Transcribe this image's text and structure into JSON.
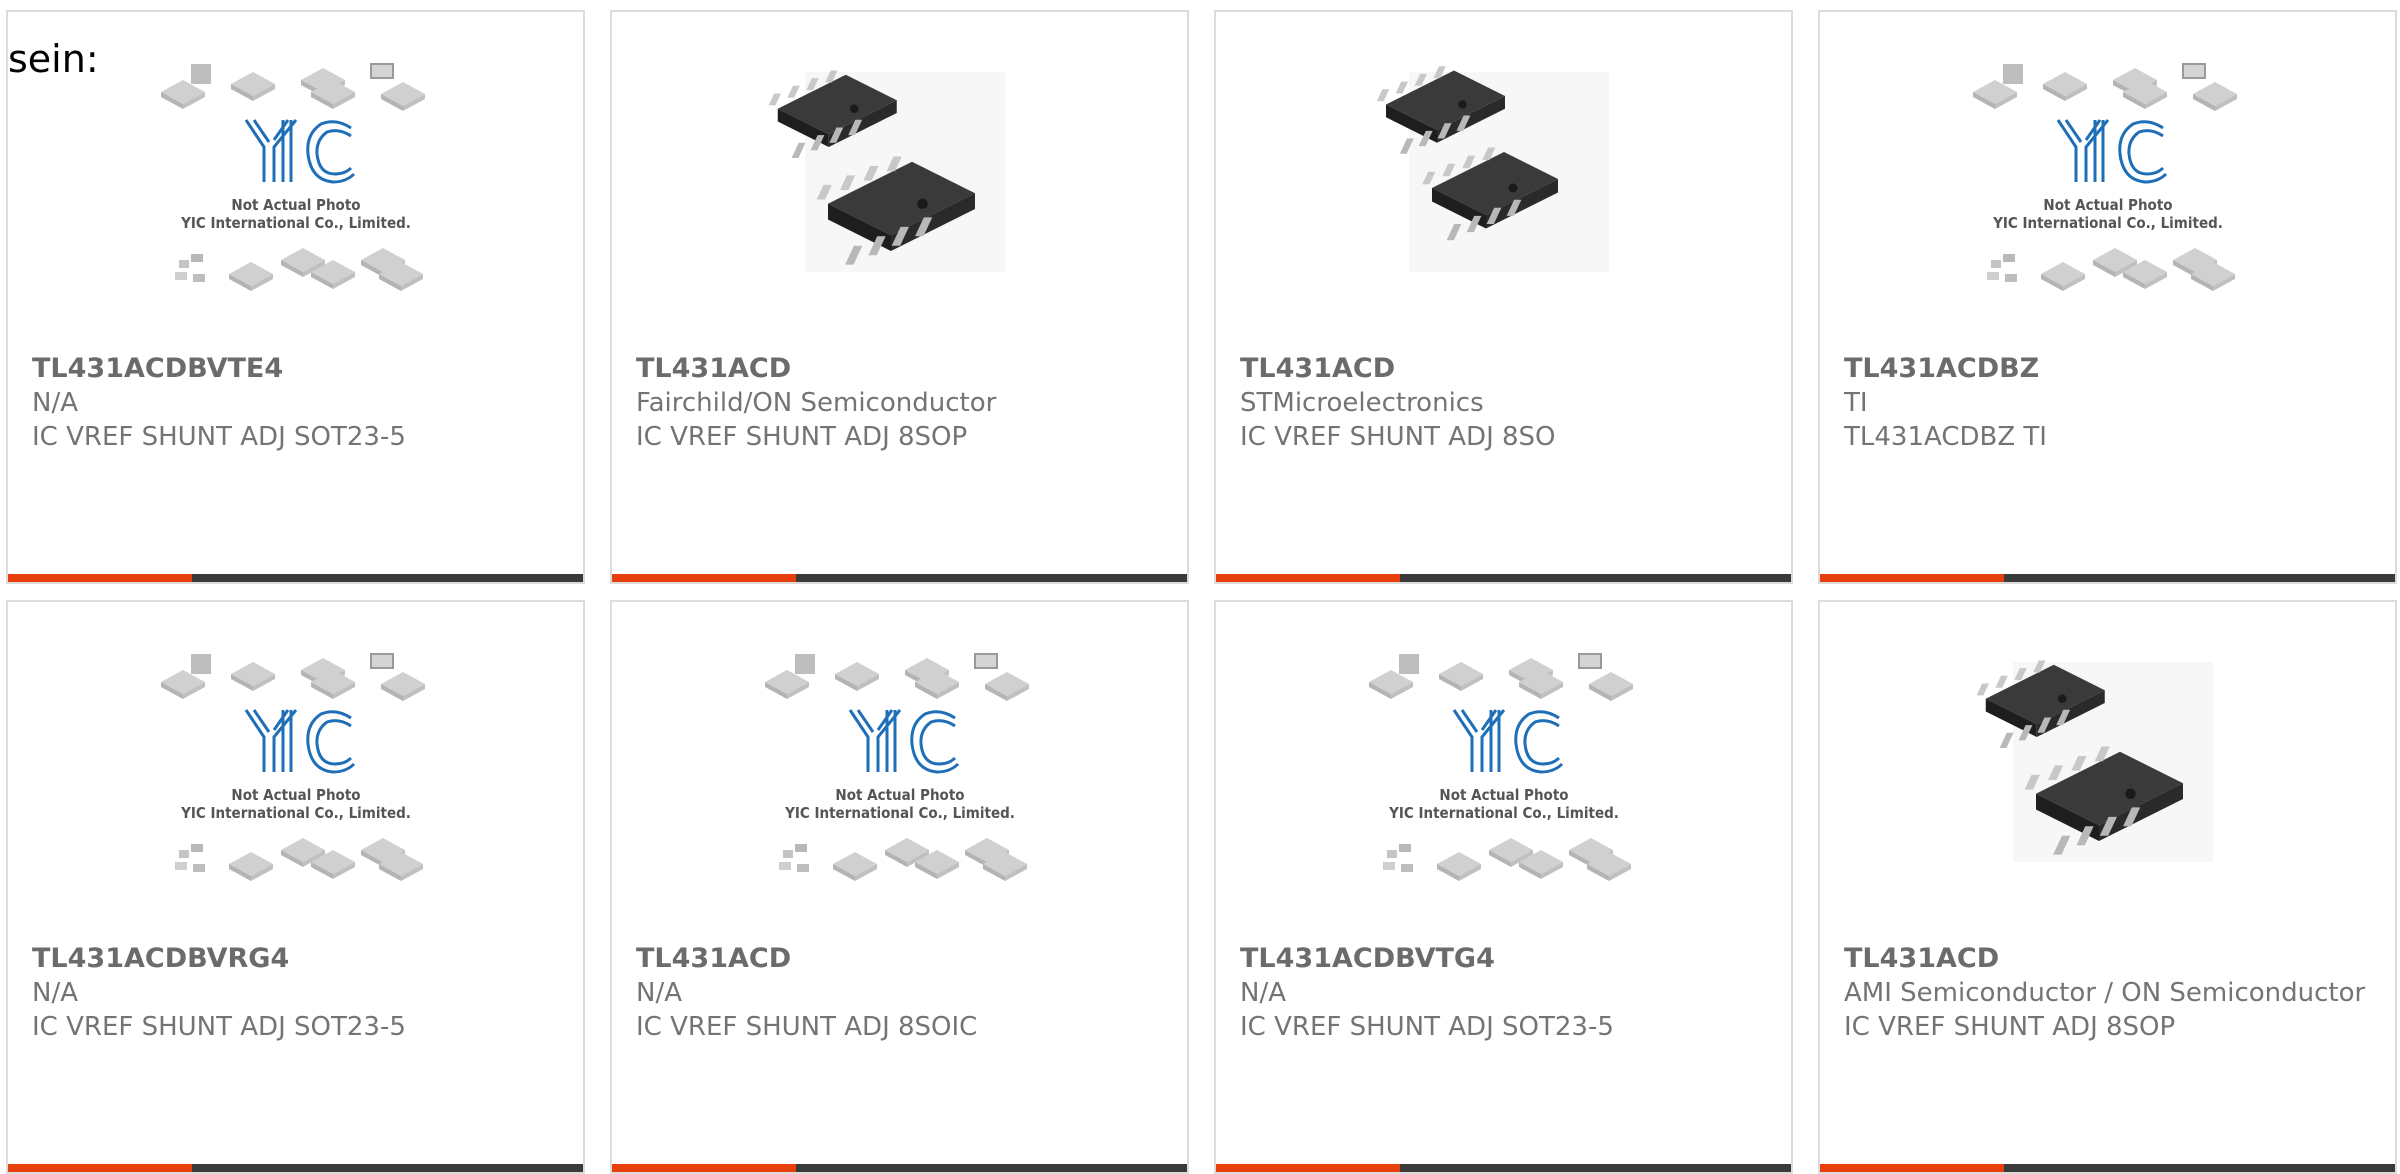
{
  "intro_text": "sein:",
  "colors": {
    "accent_bar": "#e8400c",
    "dark_bar": "#3a3a3a",
    "logo_blue": "#1f6fb8"
  },
  "placeholder_image": {
    "caption_line1": "Not Actual Photo",
    "caption_line2": "YIC International Co., Limited.",
    "logo_text": "YIC"
  },
  "products": [
    {
      "part": "TL431ACDBVTE4",
      "maker": "N/A",
      "desc": "IC VREF SHUNT ADJ SOT23-5",
      "image": "placeholder"
    },
    {
      "part": "TL431ACD",
      "maker": "Fairchild/ON Semiconductor",
      "desc": "IC VREF SHUNT ADJ 8SOP",
      "image": "soic8-photo"
    },
    {
      "part": "TL431ACD",
      "maker": "STMicroelectronics",
      "desc": "IC VREF SHUNT ADJ 8SO",
      "image": "soic8-photo-alt"
    },
    {
      "part": "TL431ACDBZ",
      "maker": "TI",
      "desc": "TL431ACDBZ TI",
      "image": "placeholder"
    },
    {
      "part": "TL431ACDBVRG4",
      "maker": "N/A",
      "desc": "IC VREF SHUNT ADJ SOT23-5",
      "image": "placeholder"
    },
    {
      "part": "TL431ACD",
      "maker": "N/A",
      "desc": "IC VREF SHUNT ADJ 8SOIC",
      "image": "placeholder"
    },
    {
      "part": "TL431ACDBVTG4",
      "maker": "N/A",
      "desc": "IC VREF SHUNT ADJ SOT23-5",
      "image": "placeholder"
    },
    {
      "part": "TL431ACD",
      "maker": "AMI Semiconductor / ON Semiconductor",
      "desc": "IC VREF SHUNT ADJ 8SOP",
      "image": "soic8-photo"
    }
  ]
}
